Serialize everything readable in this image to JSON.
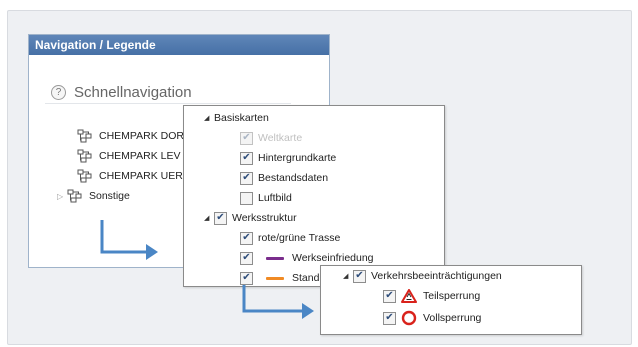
{
  "nav_panel": {
    "title": "Navigation / Legende",
    "quick_nav": {
      "label": "Schnellnavigation"
    },
    "sites": [
      {
        "label": "CHEMPARK DOR"
      },
      {
        "label": "CHEMPARK LEV"
      },
      {
        "label": "CHEMPARK UER"
      },
      {
        "label": "Sonstige"
      }
    ]
  },
  "layer_popup": {
    "group_basiskarten": "Basiskarten",
    "basiskarten": [
      {
        "label": "Weltkarte",
        "checked": true,
        "disabled": true
      },
      {
        "label": "Hintergrundkarte",
        "checked": true
      },
      {
        "label": "Bestandsdaten",
        "checked": true
      },
      {
        "label": "Luftbild",
        "checked": false
      }
    ],
    "group_werksstruktur": "Werksstruktur",
    "werksstruktur": [
      {
        "label": "rote/grüne Trasse",
        "checked": true
      },
      {
        "label": "Werkseinfriedung",
        "checked": true,
        "line_color": "#7a2d8c"
      },
      {
        "label": "Stand",
        "checked": true,
        "line_color": "#f08a24"
      }
    ]
  },
  "traffic_popup": {
    "group": "Verkehrsbeeinträchtigungen",
    "items": [
      {
        "label": "Teilsperrung",
        "icon": "warning-triangle-icon",
        "checked": true
      },
      {
        "label": "Vollsperrung",
        "icon": "red-circle-icon",
        "checked": true
      }
    ]
  },
  "colors": {
    "header": "#4670a6",
    "arrow": "#4a86c5",
    "werkseinfriedung": "#7a2d8c",
    "stand": "#f08a24",
    "warning": "#d9221b"
  }
}
